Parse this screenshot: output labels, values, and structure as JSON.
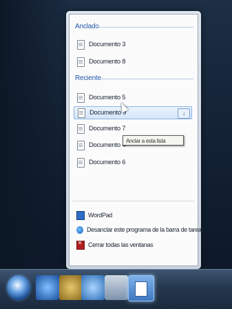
{
  "jumplist": {
    "pinned_title": "Anclado",
    "pinned": [
      "Documento 3",
      "Documento 8"
    ],
    "recent_title": "Reciente",
    "recent": [
      "Documento 5",
      "Documento 9",
      "Documento 7",
      "Documento 4",
      "Documento 6"
    ],
    "selected_index": 1,
    "tooltip": "Anclar a esta lista",
    "tasks": {
      "app": "WordPad",
      "unpin": "Desanclar este programa de la barra de tareas",
      "close": "Cerrar todas las ventanas"
    }
  },
  "taskbar": {
    "icons": [
      "windows-start-icon",
      "internet-explorer-icon",
      "explorer-folder-icon",
      "media-player-icon",
      "application-icon",
      "wordpad-icon"
    ]
  }
}
